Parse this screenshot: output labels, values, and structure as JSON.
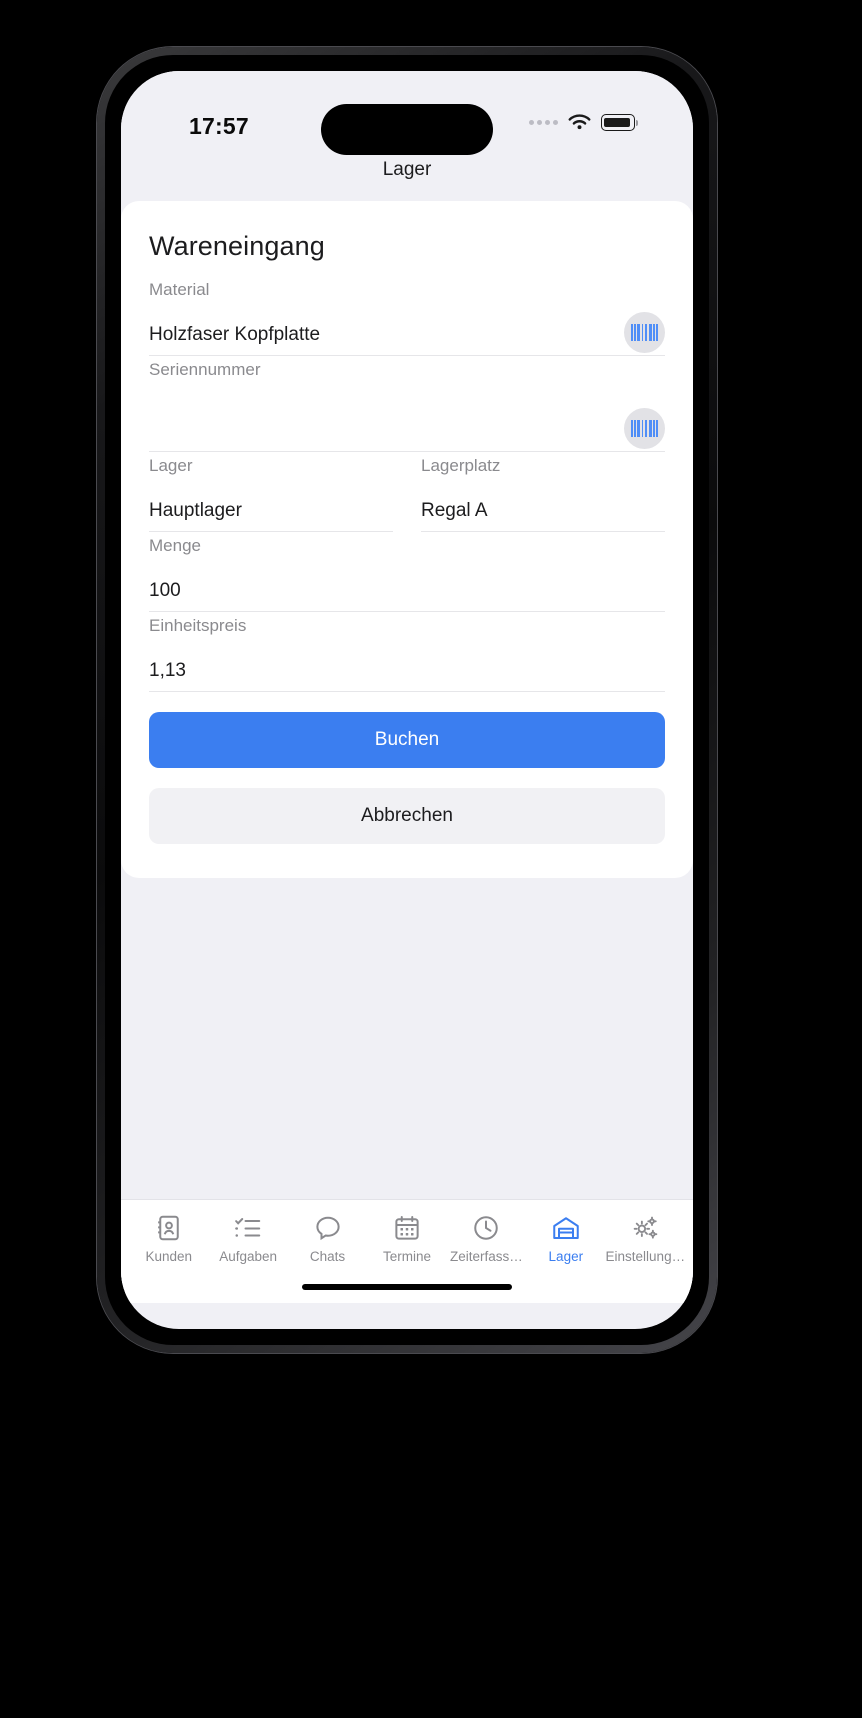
{
  "status_bar": {
    "time": "17:57",
    "wifi_icon": "wifi-icon",
    "battery_icon": "battery-icon",
    "signal_dots_icon": "signal-dots-icon"
  },
  "nav": {
    "title": "Lager"
  },
  "form": {
    "title": "Wareneingang",
    "fields": [
      {
        "label": "Material",
        "value": "Holzfaser Kopfplatte",
        "placeholder": "",
        "scan_icon": "barcode-scan-icon",
        "has_scan": true
      },
      {
        "label": "Seriennummer",
        "value": "",
        "placeholder": "",
        "scan_icon": "barcode-scan-icon",
        "has_scan": true
      },
      {
        "label": "Lager",
        "value": "Hauptlager",
        "placeholder": "",
        "has_scan": false
      },
      {
        "label": "Lagerplatz",
        "value": "Regal A",
        "placeholder": "",
        "has_scan": false
      },
      {
        "label": "Menge",
        "value": "100",
        "placeholder": "",
        "has_scan": false
      },
      {
        "label": "Einheitspreis",
        "value": "1,13",
        "placeholder": "",
        "has_scan": false
      }
    ],
    "submit_label": "Buchen",
    "cancel_label": "Abbrechen"
  },
  "colors": {
    "accent": "#3b7ef0",
    "screen_background": "#f0f0f5",
    "card_background": "#ffffff",
    "label_text": "#8a8a8e",
    "value_text": "#1c1c1e",
    "secondary_button": "#f1f1f4",
    "barcode_blue": "#4f8ef7",
    "scan_button_background": "#e2e2e6"
  },
  "tabbar": {
    "active_index": 5,
    "items": [
      {
        "label": "Kunden",
        "icon": "contacts-book-icon"
      },
      {
        "label": "Aufgaben",
        "icon": "checklist-icon"
      },
      {
        "label": "Chats",
        "icon": "speech-bubble-icon"
      },
      {
        "label": "Termine",
        "icon": "calendar-icon"
      },
      {
        "label": "Zeiterfass…",
        "icon": "clock-icon"
      },
      {
        "label": "Lager",
        "icon": "warehouse-icon"
      },
      {
        "label": "Einstellung…",
        "icon": "gears-icon"
      }
    ]
  }
}
